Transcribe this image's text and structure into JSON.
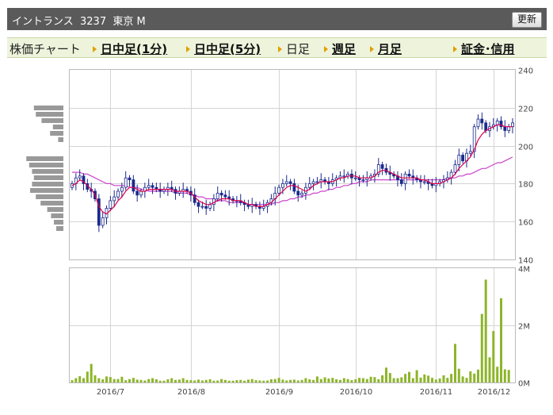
{
  "header": {
    "title": "イントランス  3237  東京 M",
    "refresh_label": "更新"
  },
  "nav": {
    "chart_label": "株価チャート",
    "items": [
      {
        "label": "日中足(1分)",
        "link": true
      },
      {
        "label": "日中足(5分)",
        "link": true
      },
      {
        "label": "日足",
        "link": false
      },
      {
        "label": "週足",
        "link": true
      },
      {
        "label": "月足",
        "link": true
      },
      {
        "label": "証金･信用",
        "link": true
      }
    ]
  },
  "colors": {
    "grid": "#d4d4d4",
    "candle_up": "#ffffff",
    "candle_down": "#1a2a8c",
    "ma_short": "#e0004a",
    "ma_long": "#cc44cc",
    "volume": "#8db52a",
    "profile": "#999999"
  },
  "chart_data": [
    {
      "type": "candlestick",
      "ylim": [
        140,
        240
      ],
      "y_ticks": [
        "240",
        "220",
        "200",
        "180",
        "160",
        "140"
      ],
      "x_labels": [
        "2016/7",
        "2016/8",
        "2016/9",
        "2016/10",
        "2016/11",
        "2016/12"
      ],
      "close": [
        180,
        183,
        184,
        180,
        177,
        176,
        172,
        158,
        162,
        167,
        171,
        173,
        176,
        178,
        183,
        182,
        176,
        174,
        176,
        178,
        179,
        178,
        177,
        176,
        177,
        178,
        177,
        175,
        176,
        177,
        176,
        174,
        170,
        168,
        168,
        167,
        169,
        172,
        175,
        174,
        173,
        172,
        171,
        171,
        170,
        169,
        168,
        169,
        168,
        167,
        168,
        170,
        172,
        175,
        178,
        180,
        181,
        180,
        176,
        174,
        175,
        178,
        180,
        181,
        181,
        182,
        181,
        180,
        182,
        183,
        184,
        184,
        185,
        183,
        183,
        182,
        182,
        183,
        184,
        185,
        190,
        188,
        186,
        185,
        184,
        182,
        180,
        185,
        184,
        183,
        182,
        181,
        181,
        180,
        179,
        180,
        181,
        182,
        183,
        186,
        190,
        195,
        192,
        196,
        197,
        210,
        214,
        212,
        208,
        210,
        211,
        213,
        210,
        208,
        210,
        212
      ],
      "ma_short": [
        179,
        180,
        182,
        181,
        179,
        177,
        174,
        168,
        165,
        164,
        166,
        168,
        171,
        173,
        176,
        178,
        178,
        177,
        176,
        176,
        177,
        177,
        177,
        177,
        177,
        177,
        177,
        176,
        176,
        176,
        176,
        175,
        173,
        171,
        170,
        169,
        169,
        170,
        171,
        172,
        172,
        172,
        171,
        171,
        171,
        170,
        169,
        169,
        168,
        168,
        168,
        169,
        170,
        172,
        174,
        176,
        178,
        179,
        179,
        178,
        177,
        176,
        177,
        179,
        180,
        181,
        181,
        181,
        181,
        182,
        183,
        183,
        184,
        184,
        184,
        183,
        183,
        183,
        183,
        184,
        186,
        187,
        187,
        186,
        185,
        184,
        183,
        183,
        183,
        183,
        183,
        182,
        182,
        181,
        180,
        180,
        180,
        181,
        182,
        183,
        185,
        188,
        190,
        192,
        194,
        198,
        203,
        206,
        208,
        209,
        210,
        211,
        211,
        210,
        210,
        210
      ],
      "ma_long": [
        186,
        186,
        186,
        185,
        185,
        184,
        183,
        182,
        181,
        180,
        180,
        179,
        179,
        179,
        179,
        178,
        178,
        178,
        177,
        177,
        176,
        176,
        176,
        176,
        176,
        176,
        176,
        175,
        175,
        175,
        175,
        174,
        174,
        173,
        173,
        172,
        172,
        172,
        171,
        171,
        171,
        170,
        170,
        170,
        170,
        170,
        169,
        169,
        169,
        169,
        169,
        169,
        169,
        170,
        170,
        171,
        171,
        172,
        172,
        173,
        173,
        174,
        174,
        175,
        175,
        176,
        176,
        177,
        177,
        178,
        178,
        179,
        179,
        180,
        180,
        181,
        181,
        181,
        182,
        182,
        182,
        182,
        182,
        182,
        182,
        182,
        182,
        182,
        182,
        182,
        182,
        182,
        182,
        182,
        182,
        182,
        182,
        182,
        183,
        183,
        183,
        184,
        184,
        185,
        185,
        186,
        187,
        188,
        188,
        189,
        190,
        191,
        191,
        192,
        193,
        194
      ]
    },
    {
      "type": "bar",
      "title": "volume",
      "ylim": [
        0,
        4000000
      ],
      "y_ticks": [
        "4M",
        "2M",
        "0M"
      ],
      "values": [
        80000,
        150000,
        220000,
        150000,
        380000,
        650000,
        250000,
        150000,
        110000,
        210000,
        190000,
        120000,
        120000,
        200000,
        80000,
        120000,
        160000,
        100000,
        90000,
        70000,
        120000,
        150000,
        110000,
        60000,
        60000,
        110000,
        150000,
        90000,
        100000,
        150000,
        90000,
        80000,
        70000,
        100000,
        70000,
        90000,
        110000,
        60000,
        70000,
        120000,
        90000,
        60000,
        60000,
        80000,
        90000,
        60000,
        100000,
        120000,
        80000,
        70000,
        60000,
        70000,
        110000,
        120000,
        160000,
        100000,
        70000,
        90000,
        100000,
        70000,
        90000,
        150000,
        110000,
        90000,
        210000,
        120000,
        180000,
        140000,
        160000,
        110000,
        90000,
        150000,
        120000,
        80000,
        110000,
        160000,
        150000,
        120000,
        200000,
        190000,
        110000,
        250000,
        520000,
        330000,
        150000,
        150000,
        180000,
        300000,
        370000,
        150000,
        430000,
        170000,
        280000,
        240000,
        160000,
        100000,
        140000,
        250000,
        160000,
        300000,
        1350000,
        480000,
        210000,
        160000,
        390000,
        310000,
        450000,
        2400000,
        3600000,
        880000,
        1800000,
        550000,
        2950000,
        460000,
        440000
      ]
    },
    {
      "type": "bar",
      "title": "price-volume-profile",
      "relative": [
        0.62,
        0.58,
        0.46,
        0.22,
        0.28,
        0.11,
        0,
        0,
        0.78,
        0.72,
        0.66,
        0.62,
        0.66,
        0.7,
        0.58,
        0.48,
        0.34,
        0.26,
        0.2,
        0.15
      ]
    }
  ]
}
